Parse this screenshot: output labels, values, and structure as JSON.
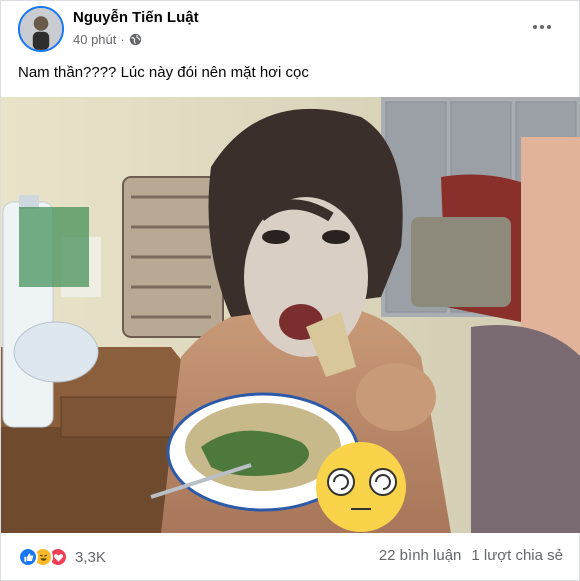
{
  "post": {
    "author": "Nguyễn Tiến Luật",
    "time": "40 phút",
    "separator": "·",
    "privacy_icon": "globe-icon",
    "caption": "Nam thần???? Lúc này đói nên mặt hơi cọc"
  },
  "footer": {
    "reaction_icons": [
      "like-icon",
      "haha-icon",
      "love-icon"
    ],
    "reaction_count": "3,3K",
    "comments": "22 bình luận",
    "shares": "1 lượt chia sẻ"
  },
  "colors": {
    "accent": "#1877f2",
    "secondary_text": "#65676b",
    "haha": "#f7b928",
    "love": "#f33e58"
  }
}
